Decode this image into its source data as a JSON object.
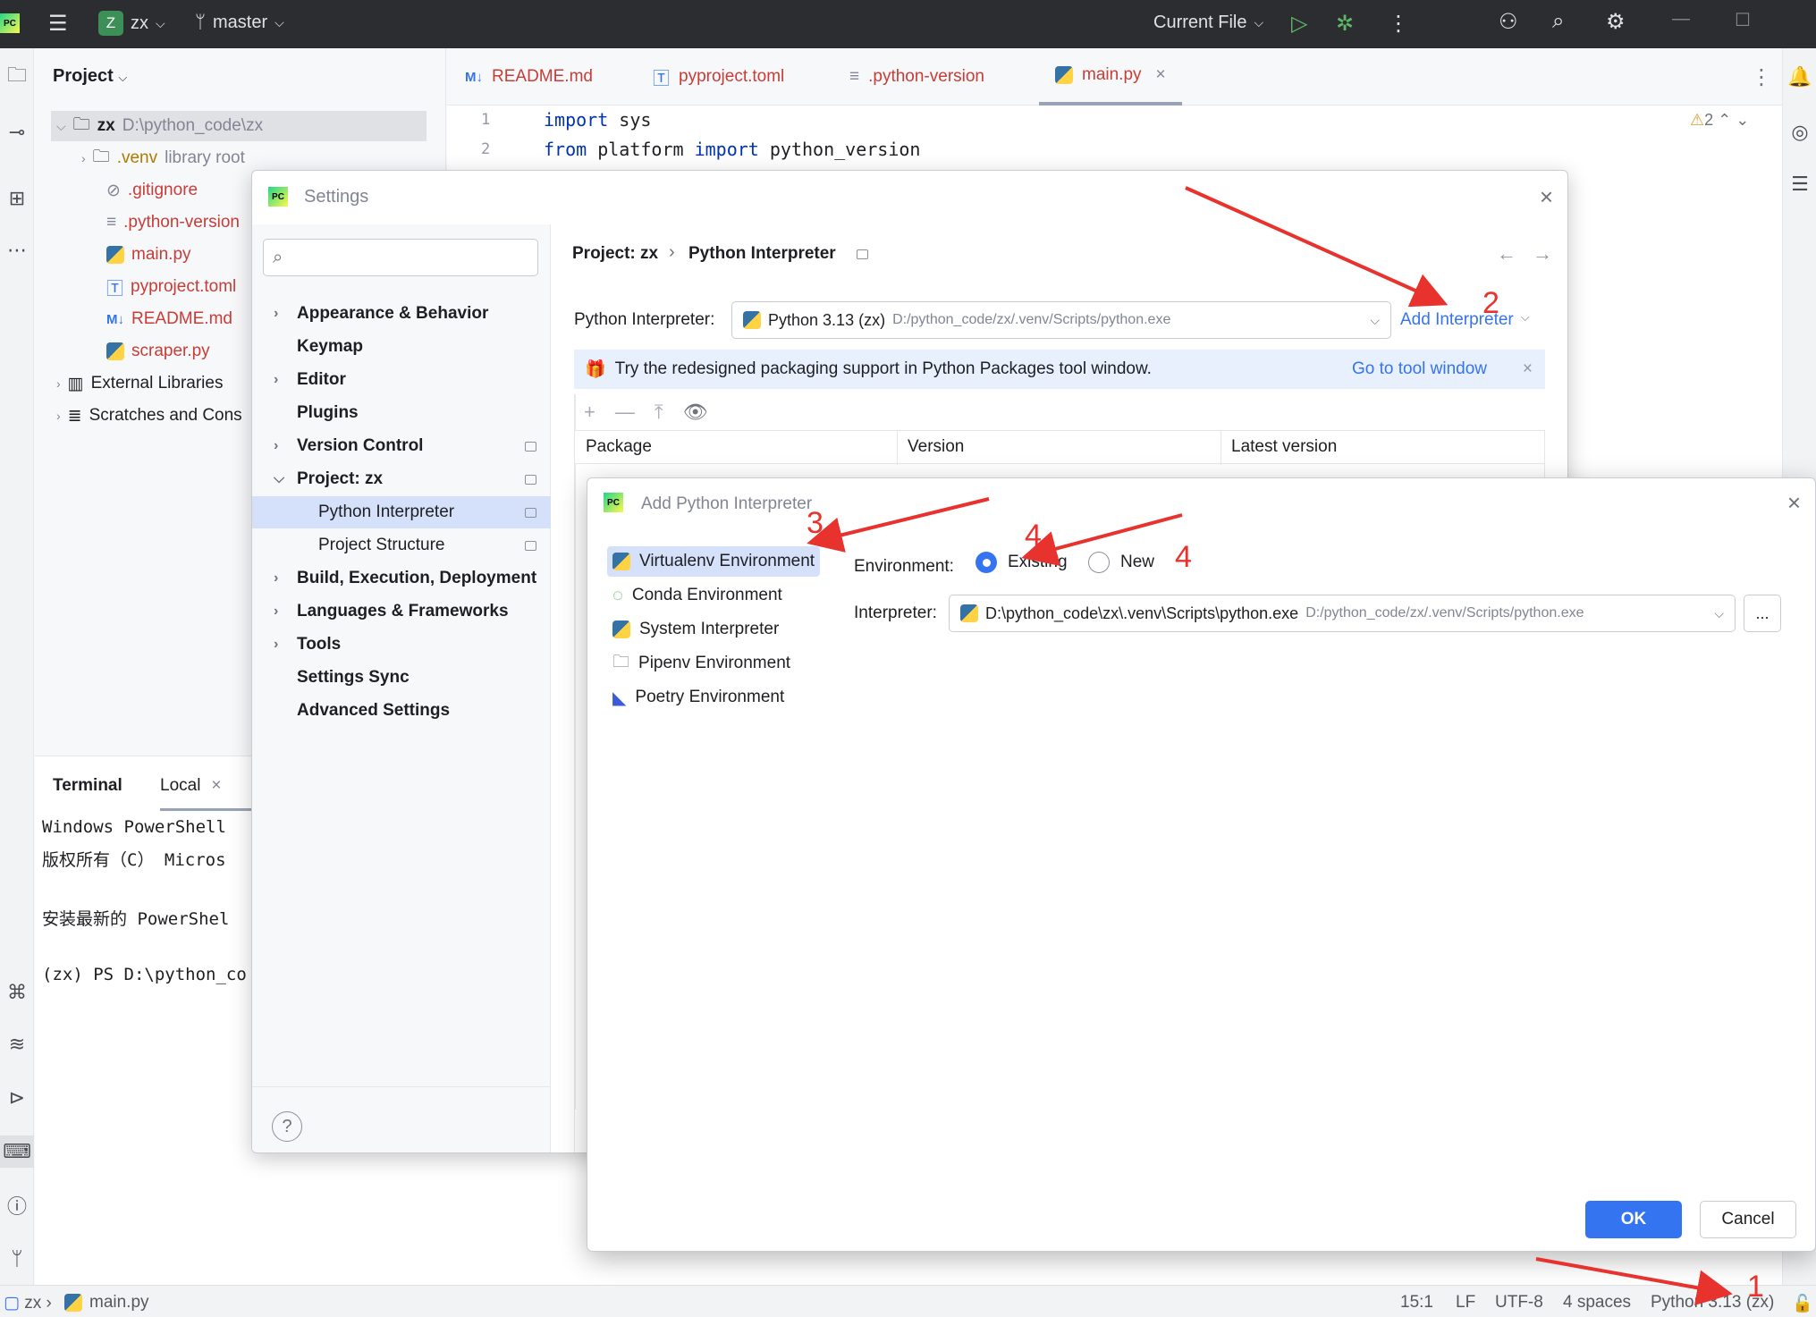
{
  "titlebar": {
    "project_badge": "Z",
    "project_name": "zx",
    "branch": "master",
    "run_config": "Current File"
  },
  "project_panel": {
    "title": "Project",
    "tree": [
      {
        "name": "zx",
        "path": "D:\\python_code\\zx"
      },
      {
        "name": ".venv",
        "path": "library root"
      },
      {
        "name": ".gitignore"
      },
      {
        "name": ".python-version"
      },
      {
        "name": "main.py"
      },
      {
        "name": "pyproject.toml"
      },
      {
        "name": "README.md"
      },
      {
        "name": "scraper.py"
      },
      {
        "name": "External Libraries"
      },
      {
        "name": "Scratches and Cons"
      }
    ]
  },
  "editor": {
    "tabs": [
      "README.md",
      "pyproject.toml",
      ".python-version",
      "main.py"
    ],
    "warnings": "2",
    "lines": [
      {
        "num": "1",
        "kw1": "import",
        "rest1": " sys",
        "kw2": "",
        "rest2": ""
      },
      {
        "num": "2",
        "kw1": "from",
        "rest1": " platform ",
        "kw2": "import",
        "rest2": " python_version"
      }
    ]
  },
  "terminal": {
    "title": "Terminal",
    "tab": "Local",
    "lines": [
      "Windows PowerShell",
      "版权所有（C） Micros",
      "",
      "安装最新的 PowerShel",
      "",
      "(zx) PS D:\\python_co"
    ]
  },
  "settings": {
    "title": "Settings",
    "search_placeholder": "",
    "nav": [
      {
        "label": "Appearance & Behavior"
      },
      {
        "label": "Keymap"
      },
      {
        "label": "Editor"
      },
      {
        "label": "Plugins"
      },
      {
        "label": "Version Control"
      },
      {
        "label": "Project: zx"
      },
      {
        "label": "Python Interpreter"
      },
      {
        "label": "Project Structure"
      },
      {
        "label": "Build, Execution, Deployment"
      },
      {
        "label": "Languages & Frameworks"
      },
      {
        "label": "Tools"
      },
      {
        "label": "Settings Sync"
      },
      {
        "label": "Advanced Settings"
      }
    ],
    "breadcrumb": [
      "Project: zx",
      "Python Interpreter"
    ],
    "interpreter_label": "Python Interpreter:",
    "interpreter_value": "Python 3.13 (zx)",
    "interpreter_path": "D:/python_code/zx/.venv/Scripts/python.exe",
    "add_interpreter": "Add Interpreter",
    "banner_text": "Try the redesigned packaging support in Python Packages tool window.",
    "banner_link": "Go to tool window",
    "table_headers": [
      "Package",
      "Version",
      "Latest version"
    ],
    "help": "?"
  },
  "add_interpreter": {
    "title": "Add Python Interpreter",
    "environments": [
      {
        "label": "Virtualenv Environment"
      },
      {
        "label": "Conda Environment"
      },
      {
        "label": "System Interpreter"
      },
      {
        "label": "Pipenv Environment"
      },
      {
        "label": "Poetry Environment"
      }
    ],
    "environment_label": "Environment:",
    "existing": "Existing",
    "new": "New",
    "interpreter_label": "Interpreter:",
    "interpreter_value": "D:\\python_code\\zx\\.venv\\Scripts\\python.exe",
    "interpreter_hint": "D:/python_code/zx/.venv/Scripts/python.exe",
    "browse": "...",
    "ok": "OK",
    "cancel": "Cancel"
  },
  "statusbar": {
    "project": "zx",
    "file": "main.py",
    "position": "15:1",
    "line_sep": "LF",
    "encoding": "UTF-8",
    "indent": "4 spaces",
    "interpreter": "Python 3.13 (zx)"
  },
  "annotations": [
    "1",
    "2",
    "3",
    "4",
    "4"
  ],
  "colors": {
    "accent": "#3574f0",
    "annotation": "#e8322d",
    "selection": "#d5e1fb"
  }
}
